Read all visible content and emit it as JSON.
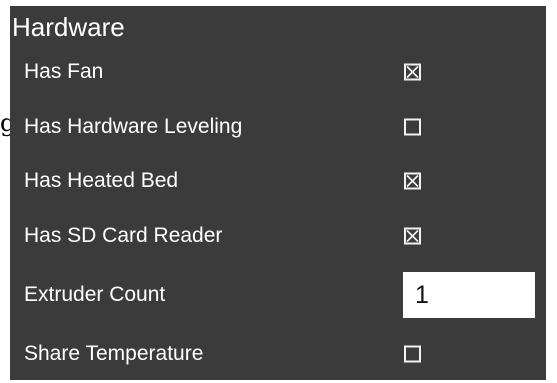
{
  "stray_glyph": "g",
  "section": {
    "title": "Hardware"
  },
  "settings": [
    {
      "label": "Has Fan",
      "checked": true
    },
    {
      "label": "Has Hardware Leveling",
      "checked": false
    },
    {
      "label": "Has Heated Bed",
      "checked": true
    },
    {
      "label": "Has SD Card Reader",
      "checked": true
    },
    {
      "label": "Extruder Count",
      "value": "1"
    },
    {
      "label": "Share Temperature",
      "checked": false
    }
  ],
  "colors": {
    "panel_background": "#3b3b3b",
    "text": "#ffffff",
    "checkbox_border": "#f2f2f2",
    "input_background": "#ffffff"
  }
}
